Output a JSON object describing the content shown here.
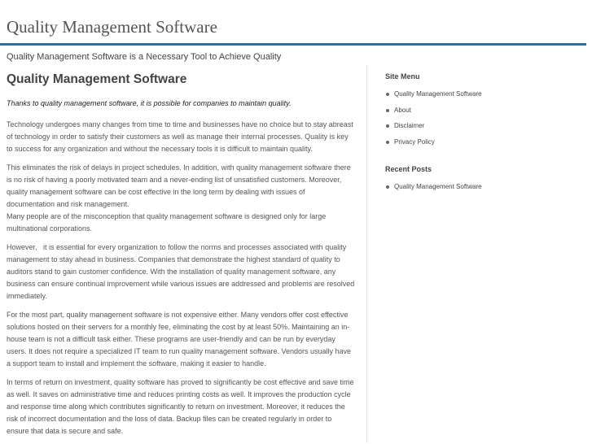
{
  "site": {
    "title": "Quality Management Software",
    "tagline": "Quality Management Software is a Necessary Tool to Achieve Quality"
  },
  "post": {
    "title": "Quality Management Software",
    "intro": "Thanks to quality management software, it is possible for companies to maintain quality.",
    "paragraphs": [
      "Technology undergoes many changes from time to time and businesses have no choice but to stay abreast of technology in order to satisfy their customers as well as manage their internal processes. Quality is key to success for any organization and without the necessary tools it is difficult to maintain quality.",
      "This eliminates the risk of delays in project schedules. In addition, with quality management software there is no risk of having a poorly motivated team and a never-ending list of unsatisfied customers. Moreover, quality management software can be cost effective in the long term by dealing with issues of documentation and risk management.\nMany people are of the misconception that quality management software is designed only for large multinational corporations.",
      "However,   it is essential for every organization to follow the norms and processes associated with quality management to stay ahead in business. Companies that demonstrate the highest standard of quality to auditors stand to gain customer confidence. With the installation of quality management software, any business can ensure continual improvement while various issues are addressed and problems are resolved immediately.",
      "For the most part, quality management software is not expensive either. Many vendors offer cost effective solutions hosted on their servers for a monthly fee, eliminating the cost by at least 50%. Maintaining an in-house team is not a difficult task either. These programs are user-friendly and can be run by everyday users. It does not require a specialized IT team to run quality management software. Vendors usually have a support team to install and implement the software, making it easier to handle.",
      "In terms of return on investment, quality software has proved to significantly be cost effective and save time as well. It saves on administrative time and reduces printing costs as well. It improves the production cycle and response time along which contributes significantly to return on investment. Moreover, it reduces the risk of incorrect documentation and the loss of data. Backup files can be created regularly in order to ensure that data is secure and safe."
    ]
  },
  "sidebar": {
    "menu_title": "Site Menu",
    "menu_items": [
      "Quality Management Software",
      "About",
      "Disclaimer",
      "Privacy Policy"
    ],
    "recent_title": "Recent Posts",
    "recent_items": [
      "Quality Management Software"
    ]
  },
  "colors": {
    "accent": "#1e73be",
    "text": "#555555"
  }
}
